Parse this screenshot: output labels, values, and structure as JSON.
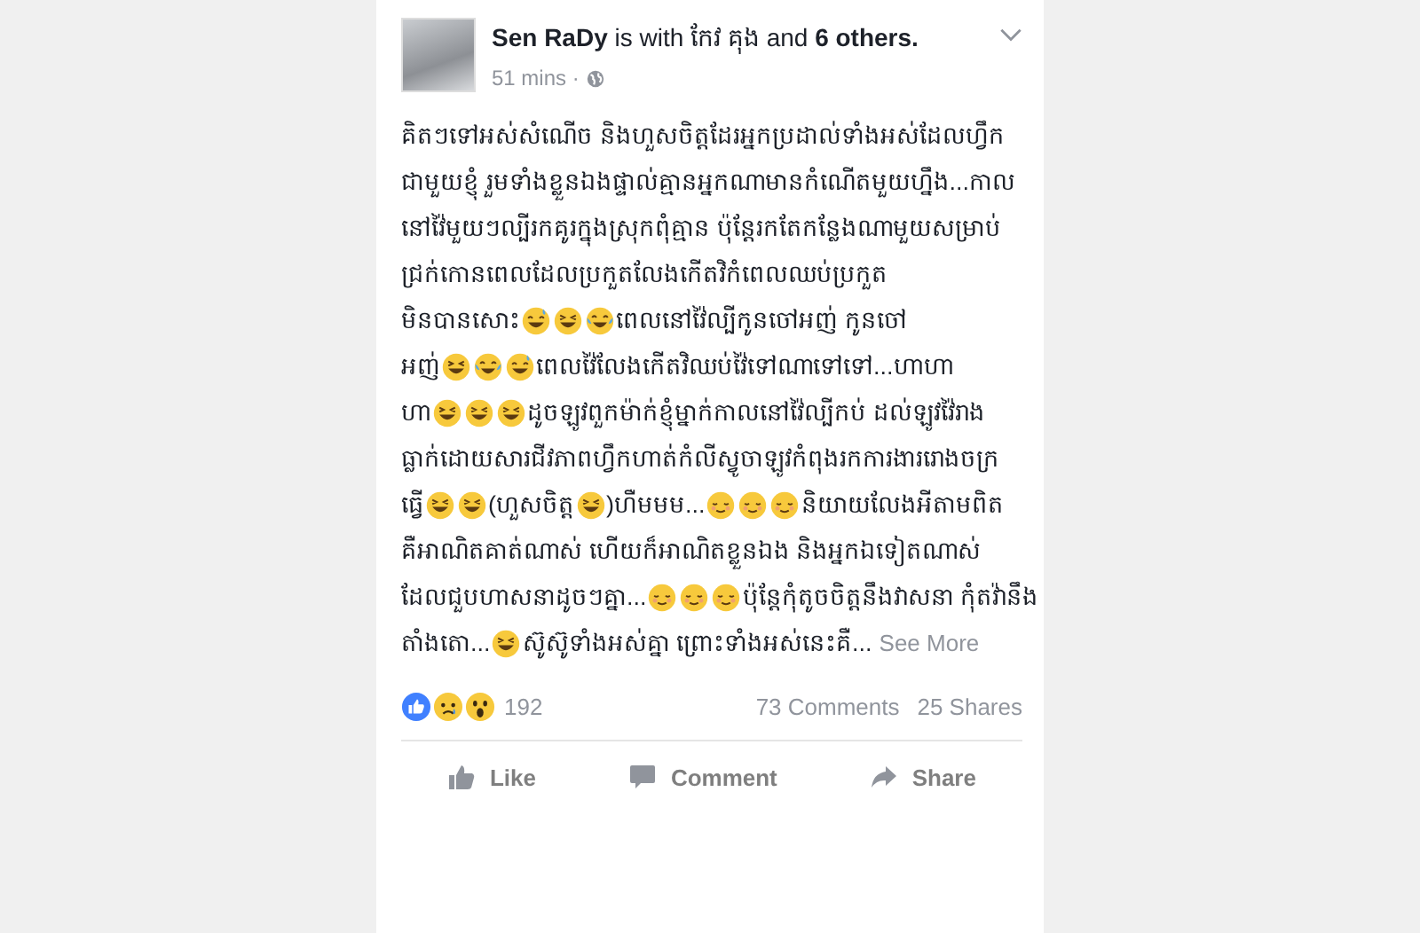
{
  "post": {
    "author_line": "**Sen RaDy** is with កែវ គុង and **6 others.**",
    "time": "51 mins ·",
    "lines": [
      [
        {
          "kind": "text",
          "text": "គិតៗទៅអស់សំណើច និងហួសចិត្តដែរអ្នកប្រដាល់ទាំងអស់ដែលហ្វឹក"
        }
      ],
      [
        {
          "kind": "text",
          "text": "ជាមួយខ្ញុំ រួមទាំងខ្លួនឯងផ្ទាល់គ្មានអ្នកណាមានកំណើតមួយហ្នឹង...កាល"
        }
      ],
      [
        {
          "kind": "text",
          "text": "នៅវ៉ៃមួយៗល្បីរកគូរក្នុងស្រុកពុំគ្មាន ប៉ុន្តែរកតែកន្លែងណាមួយសម្រាប់"
        }
      ],
      [
        {
          "kind": "text",
          "text": "ជ្រក់កោនពេលដែលប្រកួតលែងកើតវិកំពេលឈប់ប្រកួត"
        }
      ],
      [
        {
          "kind": "text",
          "text": "មិនបានសោះ"
        },
        {
          "kind": "sweat_smile"
        },
        {
          "kind": "laugh"
        },
        {
          "kind": "joy"
        },
        {
          "kind": "text",
          "text": "ពេលនៅវ៉ៃល្បីកូនចៅអញ់ កូនចៅ"
        }
      ],
      [
        {
          "kind": "text",
          "text": "អញ់"
        },
        {
          "kind": "laugh"
        },
        {
          "kind": "joy"
        },
        {
          "kind": "sweat_smile"
        },
        {
          "kind": "text",
          "text": "ពេលវ៉ៃលែងកើតវិឈប់វ៉ៃទៅណាទៅទៅ...ហាហា"
        }
      ],
      [
        {
          "kind": "text",
          "text": "ហា"
        },
        {
          "kind": "laugh"
        },
        {
          "kind": "laugh"
        },
        {
          "kind": "laugh"
        },
        {
          "kind": "text",
          "text": "ដូចឡូវពួកម៉ាក់ខ្ញុំម្នាក់កាលនៅវ៉ៃល្បីកប់ ដល់ឡូវវ៉ៃរាង"
        }
      ],
      [
        {
          "kind": "text",
          "text": "ធ្លាក់ដោយសារជីវភាពហ្វឹកហាត់កំលីស្វូចាឡូវកំពុងរកការងាររោងចក្រ"
        }
      ],
      [
        {
          "kind": "text",
          "text": "ធ្វើ"
        },
        {
          "kind": "laugh"
        },
        {
          "kind": "laugh"
        },
        {
          "kind": "text",
          "text": "(ហួសចិត្ត"
        },
        {
          "kind": "laugh"
        },
        {
          "kind": "text",
          "text": ")ហឺមមម..."
        },
        {
          "kind": "relieved"
        },
        {
          "kind": "relieved"
        },
        {
          "kind": "relieved"
        },
        {
          "kind": "text",
          "text": "និយាយលែងអីតាមពិត"
        }
      ],
      [
        {
          "kind": "text",
          "text": "គឺអាណិតគាត់ណាស់ ហើយក៏អាណិតខ្លួនឯង និងអ្នកឯទៀតណាស់"
        }
      ],
      [
        {
          "kind": "text",
          "text": "ដែលជួបហាសនាដូចៗគ្នា..."
        },
        {
          "kind": "relieved"
        },
        {
          "kind": "relieved"
        },
        {
          "kind": "relieved"
        },
        {
          "kind": "text",
          "text": "ប៉ុន្តែកុំតូចចិត្តនឹងវាសនា កុំតវ៉ានឹង"
        }
      ],
      [
        {
          "kind": "text",
          "text": "តាំងតោ..."
        },
        {
          "kind": "laugh"
        },
        {
          "kind": "text",
          "text": "ស៊ូស៊ូទាំងអស់គ្នា ព្រោះទាំងអស់នេះគឺ..."
        }
      ]
    ],
    "see_more": "See More",
    "reactions": [
      {
        "kind": "like"
      },
      {
        "kind": "sad"
      },
      {
        "kind": "wow"
      }
    ],
    "reaction_count": "192",
    "comments": "73 Comments",
    "shares": "25 Shares",
    "actions": [
      {
        "kind": "like",
        "label": "Like"
      },
      {
        "kind": "comment",
        "label": "Comment"
      },
      {
        "kind": "share",
        "label": "Share"
      }
    ]
  }
}
